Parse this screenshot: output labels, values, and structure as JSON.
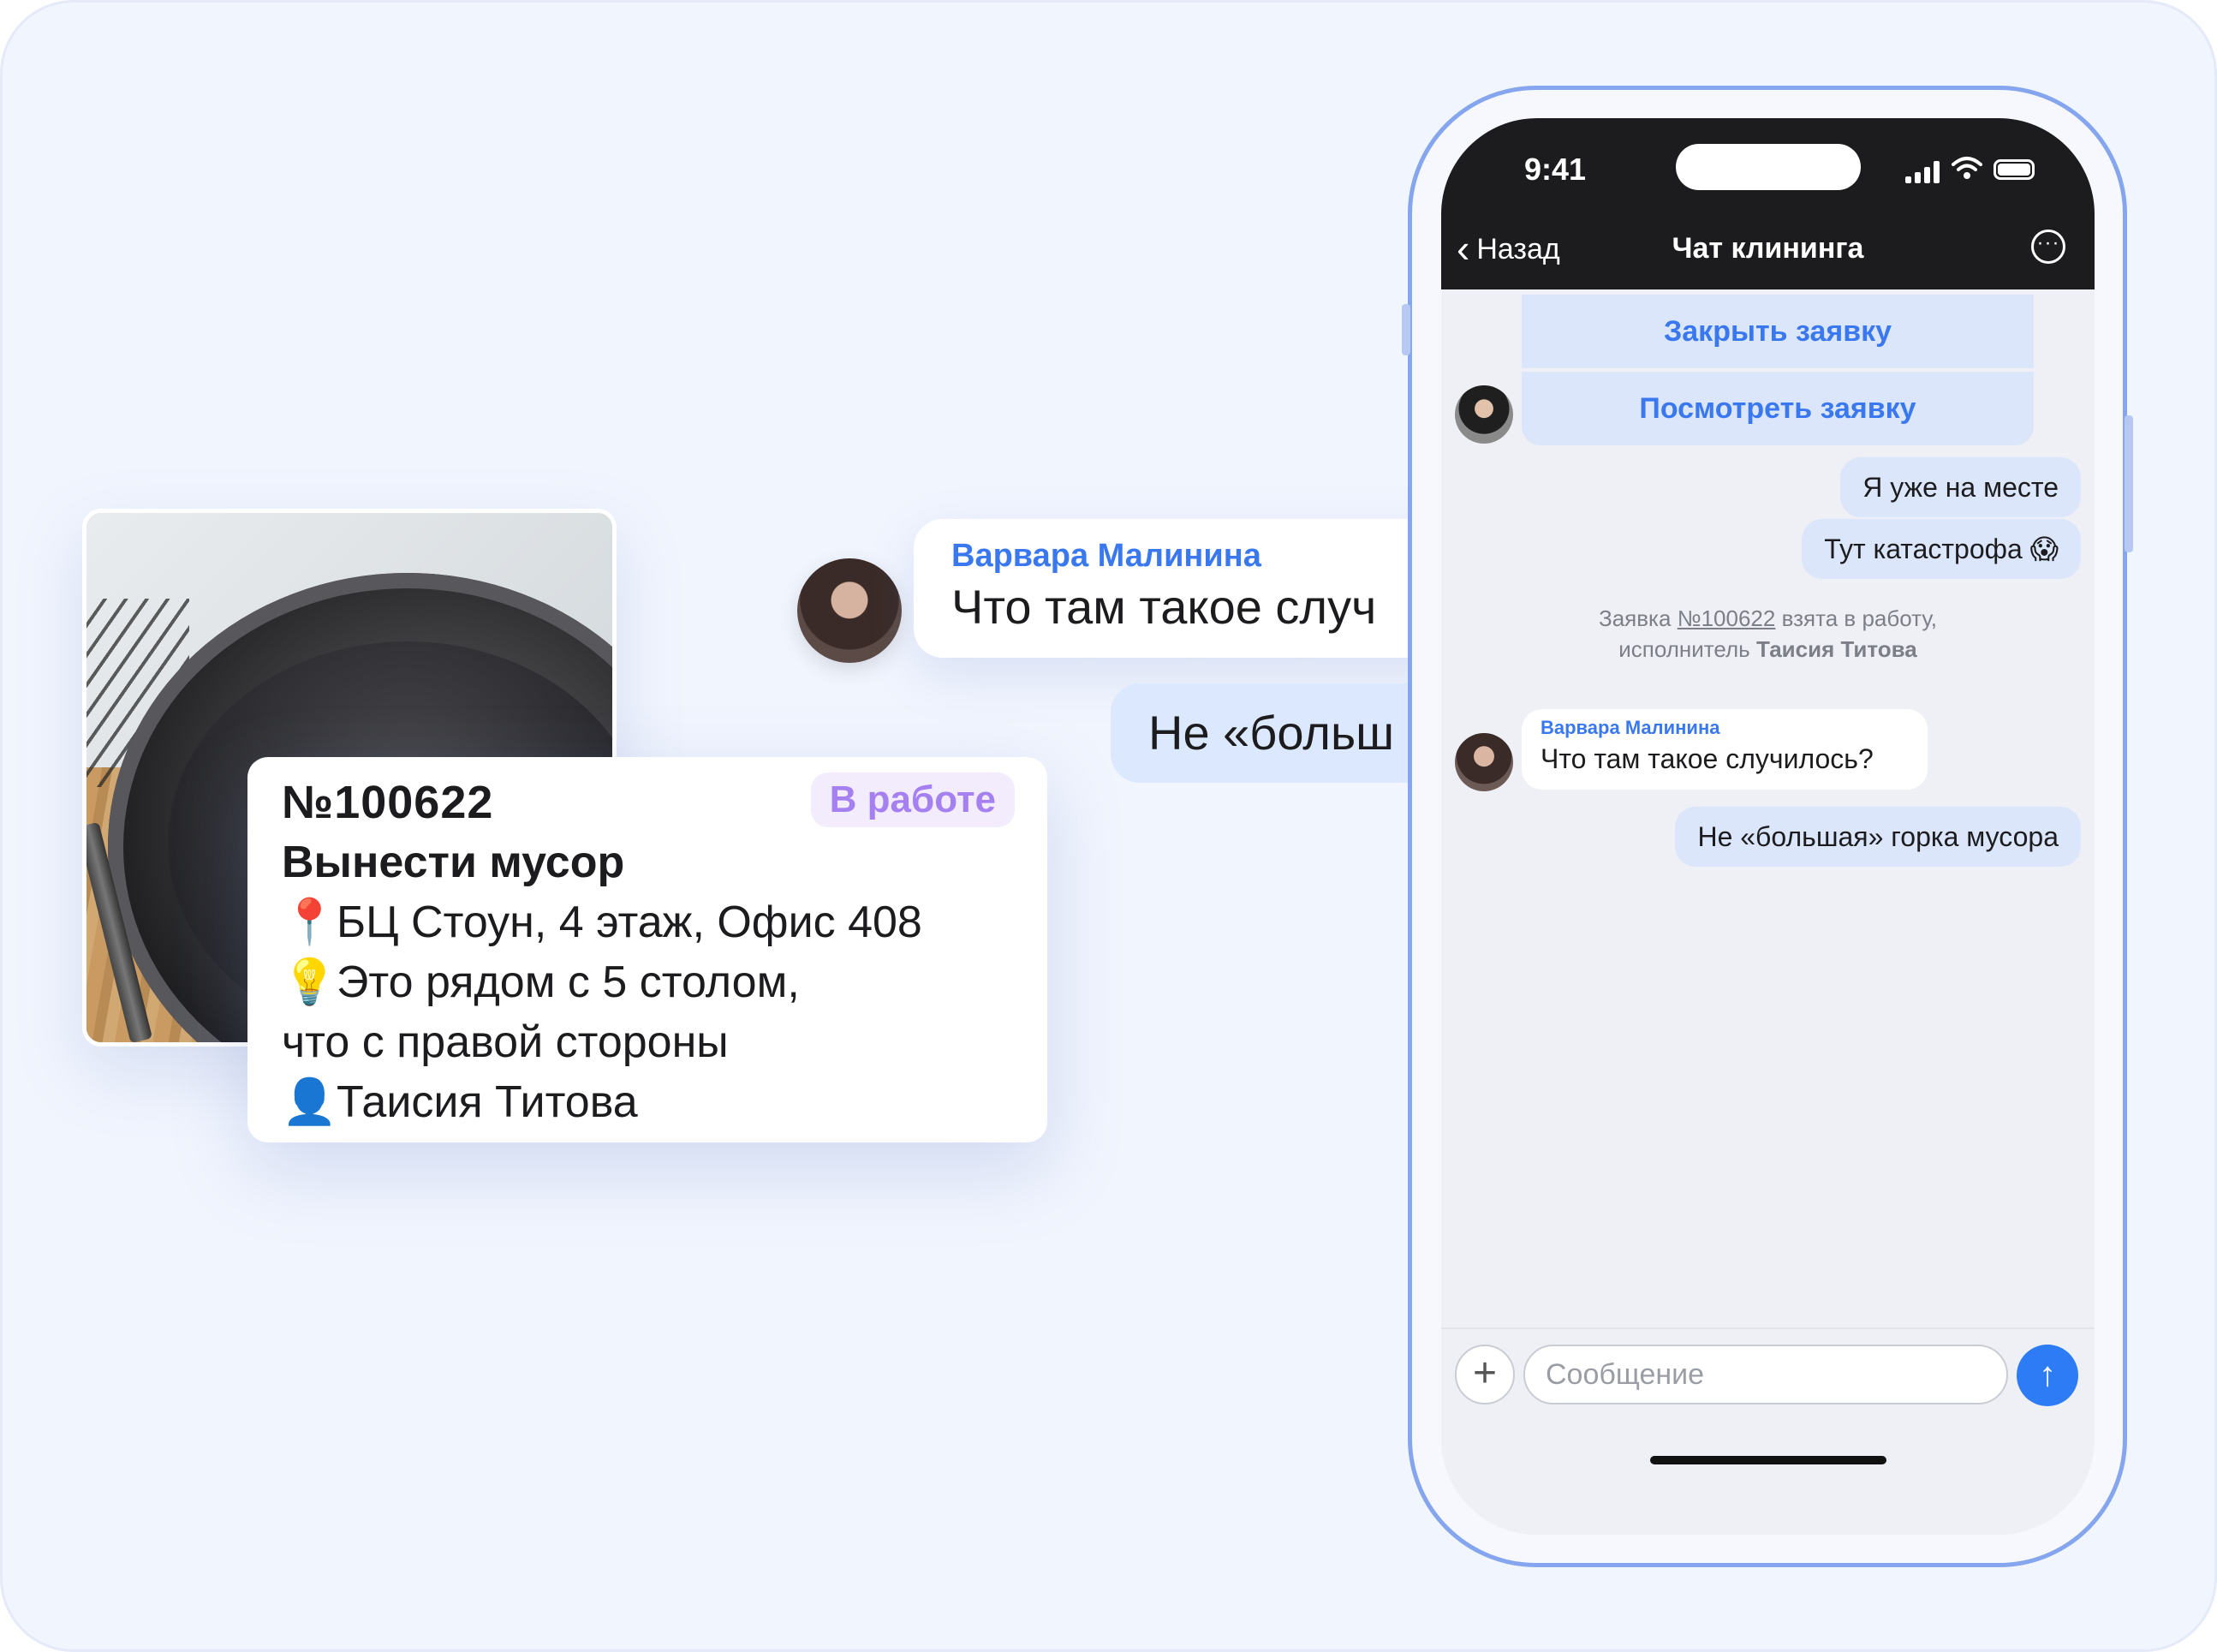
{
  "ticket_card": {
    "number": "№100622",
    "status": "В работе",
    "task": "Вынести мусор",
    "location_icon": "📍",
    "location": "БЦ Стоун, 4 этаж, Офис 408",
    "hint_icon": "💡",
    "hint_line1": "Это рядом с 5 столом,",
    "hint_line2": "что с правой стороны",
    "assignee_icon": "👤",
    "assignee": "Таисия Титова",
    "status_color": "#a580f1"
  },
  "floating_messages": {
    "incoming_author": "Варвара Малинина",
    "incoming_text": "Что там такое случ",
    "outgoing_text": "Не «больш"
  },
  "phone": {
    "status_time": "9:41",
    "nav": {
      "back_label": "Назад",
      "title": "Чат клининга",
      "back_icon": "chevron-left-icon",
      "more_icon": "ellipsis-circle-icon"
    },
    "actions": {
      "close_request": "Закрыть заявку",
      "view_request": "Посмотреть заявку"
    },
    "messages": {
      "out_1": "Я уже на месте",
      "out_2": "Тут катастрофа 😱",
      "system_prefix": "Заявка",
      "system_ticket": "№100622",
      "system_mid": "взята в работу,",
      "system_role": "исполнитель",
      "system_person": "Таисия Титова",
      "in_author": "Варвара Малинина",
      "in_text": "Что там такое случилось?",
      "out_3": "Не «большая» горка мусора"
    },
    "composer": {
      "placeholder": "Сообщение",
      "plus_icon": "plus-icon",
      "send_icon": "arrow-up-icon"
    },
    "accent_color": "#3a78f0"
  }
}
